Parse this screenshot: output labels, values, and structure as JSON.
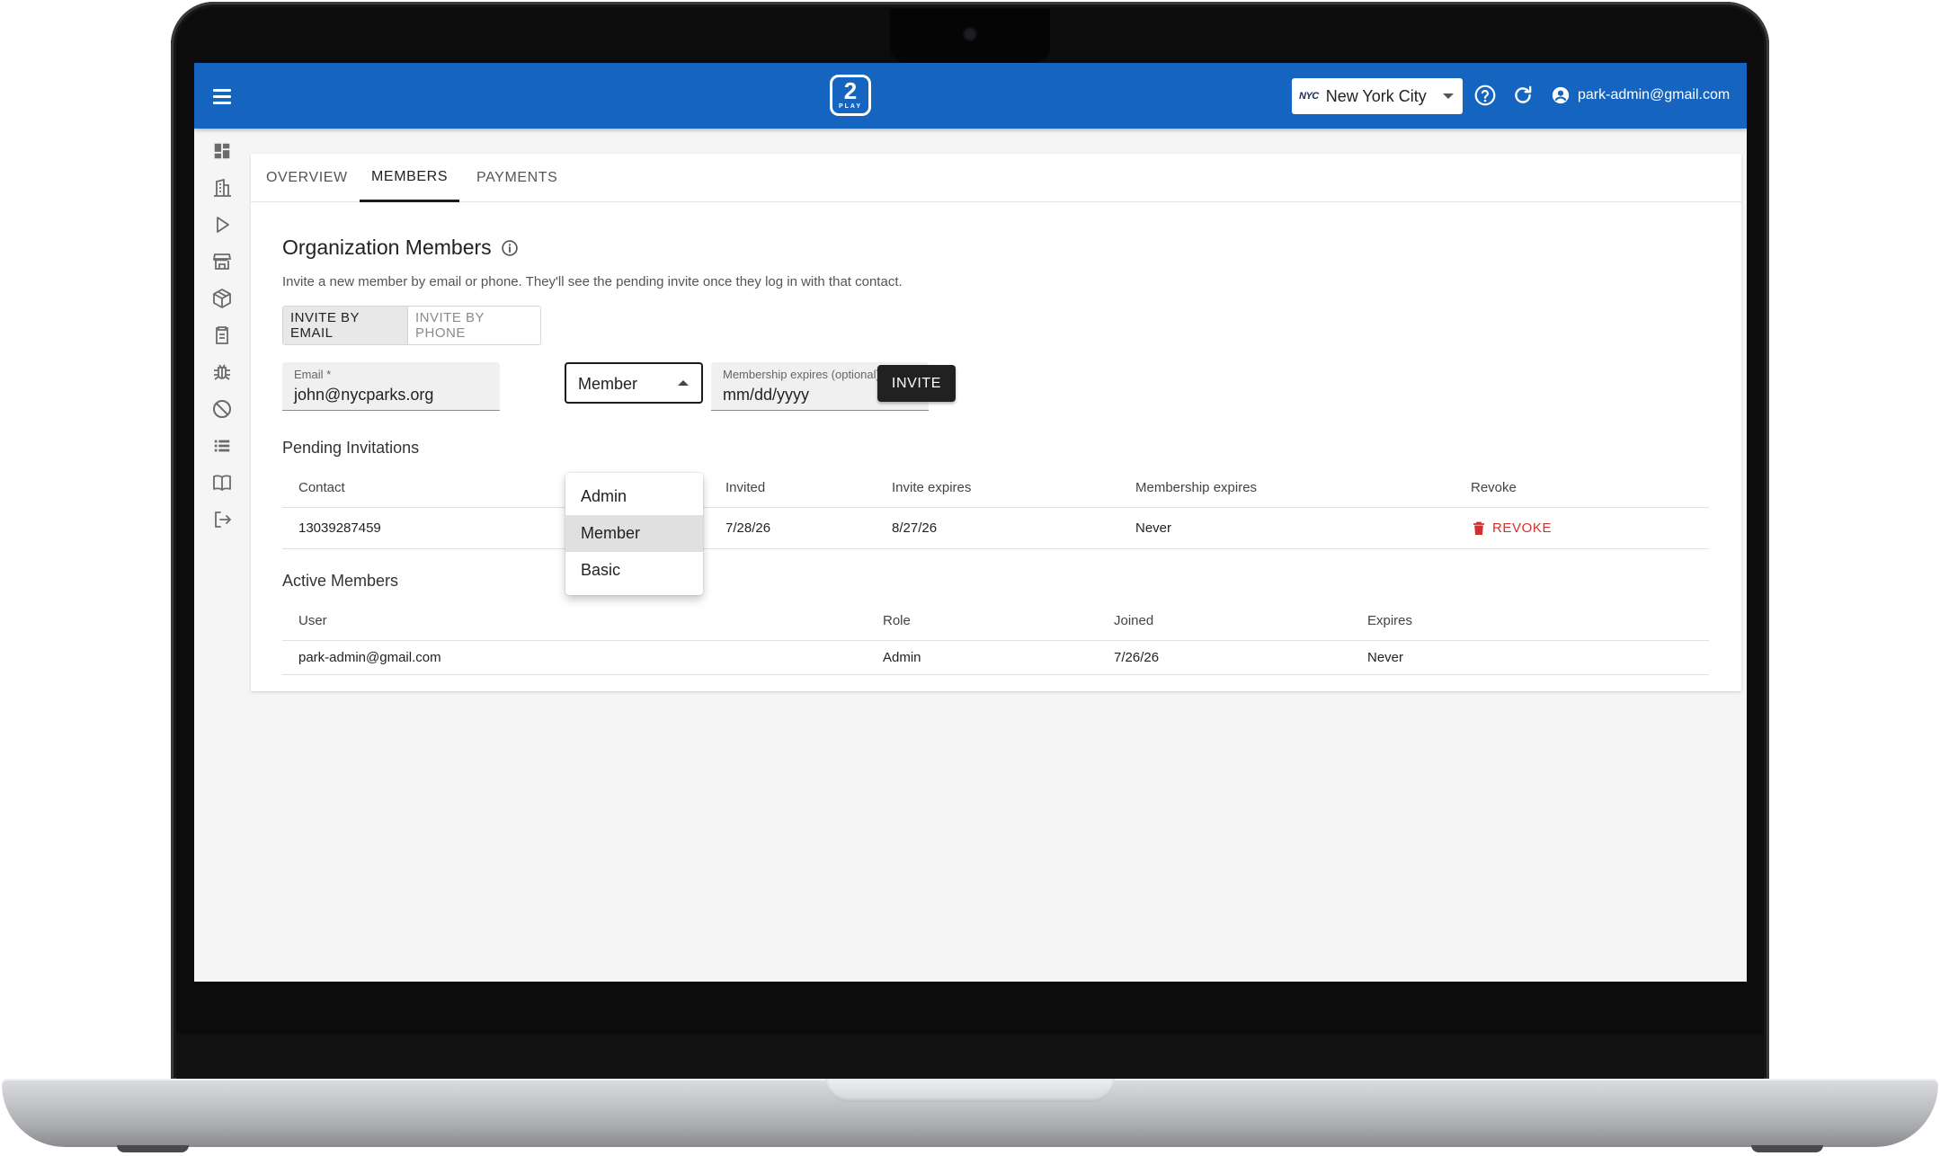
{
  "app": {
    "logo_number": "2",
    "logo_sub": "PLAY",
    "city_badge": "NYC",
    "city": "New York City",
    "user_email": "park-admin@gmail.com"
  },
  "tabs": [
    {
      "label": "OVERVIEW",
      "active": false
    },
    {
      "label": "MEMBERS",
      "active": true
    },
    {
      "label": "PAYMENTS",
      "active": false
    }
  ],
  "members": {
    "title": "Organization Members",
    "description": "Invite a new member by email or phone. They'll see the pending invite once they log in with that contact.",
    "invite_mode": {
      "email_label": "INVITE BY EMAIL",
      "phone_label": "INVITE BY PHONE",
      "selected": "email"
    },
    "email_field": {
      "label": "Email *",
      "value": "john@nycparks.org"
    },
    "role_select": {
      "value": "Member",
      "options": [
        "Admin",
        "Member",
        "Basic"
      ],
      "open": true
    },
    "expires_field": {
      "label": "Membership expires (optional)",
      "value": "mm/dd/yyyy"
    },
    "invite_button": "INVITE"
  },
  "pending": {
    "title": "Pending Invitations",
    "headers": [
      "Contact",
      "Invited",
      "Invite expires",
      "Membership expires",
      "Revoke"
    ],
    "rows": [
      {
        "contact": "13039287459",
        "invited": "7/28/26",
        "invite_expires": "8/27/26",
        "membership_expires": "Never",
        "revoke": "REVOKE"
      }
    ]
  },
  "active": {
    "title": "Active Members",
    "headers": [
      "User",
      "Role",
      "Joined",
      "Expires"
    ],
    "rows": [
      {
        "user": "park-admin@gmail.com",
        "role": "Admin",
        "joined": "7/26/26",
        "expires": "Never"
      }
    ]
  },
  "colors": {
    "appbar": "#1565c0",
    "revoke": "#d32f2f",
    "invite_button": "#212121"
  },
  "icons": {
    "sidenav": [
      "dashboard-icon",
      "building-icon",
      "play-icon",
      "store-icon",
      "package-icon",
      "clipboard-icon",
      "bug-icon",
      "block-icon",
      "list-icon",
      "book-icon",
      "logout-icon"
    ],
    "appbar": [
      "menu-icon",
      "help-icon",
      "refresh-icon",
      "account-icon"
    ]
  }
}
